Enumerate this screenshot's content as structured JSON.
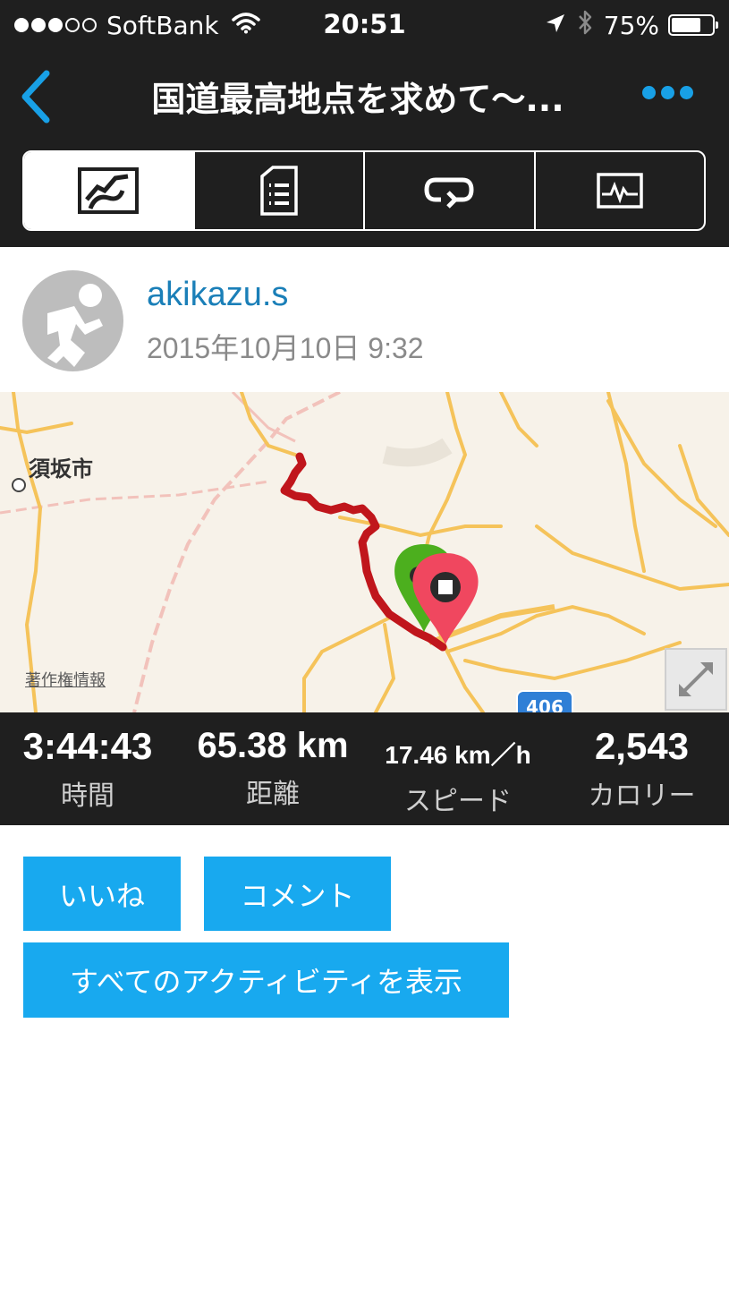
{
  "status_bar": {
    "carrier": "SoftBank",
    "time": "20:51",
    "battery_percent": "75%",
    "battery_level": 0.75,
    "icons": [
      "signal-dots-icon",
      "wifi-icon",
      "location-arrow-icon",
      "bluetooth-icon",
      "battery-icon"
    ]
  },
  "nav": {
    "title": "国道最高地点を求めて～...",
    "back_icon": "chevron-left-icon",
    "more_icon": "more-dots-icon"
  },
  "tabs": [
    {
      "name": "map",
      "icon": "map-icon",
      "active": true
    },
    {
      "name": "details",
      "icon": "list-document-icon",
      "active": false
    },
    {
      "name": "laps",
      "icon": "loop-arrow-icon",
      "active": false
    },
    {
      "name": "graph",
      "icon": "activity-graph-icon",
      "active": false
    }
  ],
  "profile": {
    "username": "akikazu.s",
    "datetime": "2015年10月10日 9:32",
    "avatar_icon": "runner-avatar-icon"
  },
  "map": {
    "city_label": "須坂市",
    "credit": "著作権情報",
    "route_number": "406",
    "expand_icon": "expand-arrows-icon",
    "start_marker_icon": "start-pin-icon",
    "end_marker_icon": "stop-pin-icon"
  },
  "stats": [
    {
      "value": "3:44:43",
      "label": "時間"
    },
    {
      "value": "65.38 km",
      "label": "距離"
    },
    {
      "value": "17.46 km／h",
      "label": "スピード"
    },
    {
      "value": "2,543",
      "label": "カロリー"
    }
  ],
  "buttons": {
    "like": "いいね",
    "comment": "コメント",
    "all_activities": "すべてのアクティビティを表示"
  },
  "colors": {
    "bar_background": "#1f1f1f",
    "accent": "#18a9ef",
    "username": "#1a7fb8",
    "route": "#c0161c",
    "start_marker": "#4caf1e",
    "end_marker": "#f0475f"
  }
}
